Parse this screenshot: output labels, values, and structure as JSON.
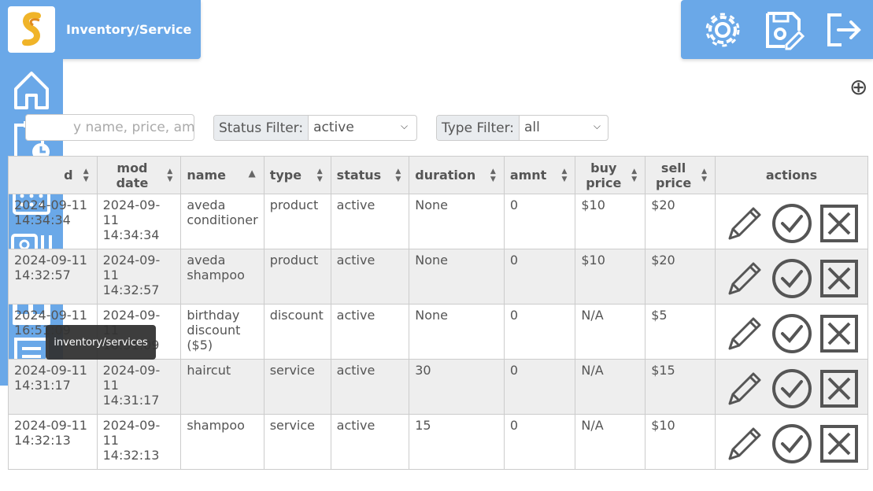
{
  "app": {
    "title": "Inventory/Service"
  },
  "tooltip": "inventory/services",
  "search": {
    "placeholder": "y name, price, amnt"
  },
  "filters": {
    "status_label": "Status Filter:",
    "status_value": "active",
    "type_label": "Type Filter:",
    "type_value": "all"
  },
  "table": {
    "headers": [
      "d",
      "mod date",
      "name",
      "type",
      "status",
      "duration",
      "amnt",
      "buy price",
      "sell price",
      "actions"
    ],
    "rows": [
      [
        "2024-09-11 14:34:34",
        "2024-09-11 14:34:34",
        "aveda conditioner",
        "product",
        "active",
        "None",
        "0",
        "$10",
        "$20"
      ],
      [
        "2024-09-11 14:32:57",
        "2024-09-11 14:32:57",
        "aveda shampoo",
        "product",
        "active",
        "None",
        "0",
        "$10",
        "$20"
      ],
      [
        "2024-09-11 16:51:09",
        "2024-09-11 16:51:09",
        "birthday discount ($5)",
        "discount",
        "active",
        "None",
        "0",
        "N/A",
        "$5"
      ],
      [
        "2024-09-11 14:31:17",
        "2024-09-11 14:31:17",
        "haircut",
        "service",
        "active",
        "30",
        "0",
        "N/A",
        "$15"
      ],
      [
        "2024-09-11 14:32:13",
        "2024-09-11 14:32:13",
        "shampoo",
        "service",
        "active",
        "15",
        "0",
        "N/A",
        "$10"
      ]
    ]
  },
  "icons": {
    "logo": "logo-icon",
    "settings": "gear-icon",
    "save": "save-edit-icon",
    "logout": "logout-icon",
    "add": "add-icon",
    "sidebar": [
      "home-icon",
      "calendar-clock-icon",
      "calendar-icon",
      "contacts-icon",
      "inventory-icon",
      "receipt-icon"
    ]
  }
}
